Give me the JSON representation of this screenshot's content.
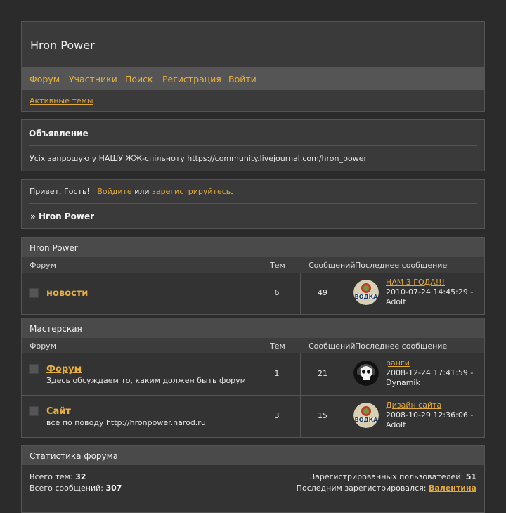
{
  "site": {
    "title": "Hron Power",
    "nav": [
      "Форум",
      "Участники",
      "Поиск",
      "Регистрация",
      "Войти"
    ],
    "active_topics": "Активные темы"
  },
  "announcement": {
    "heading": "Объявление",
    "text": "Усіх запрошую у НАШУ ЖЖ-спільноту https://community.livejournal.com/hron_power"
  },
  "welcome": {
    "greeting": "Привет, Гость!",
    "login": "Войдите",
    "or": "или",
    "register": "зарегистрируйтесь",
    "dot": ".",
    "crumb_sep": "»",
    "crumb": "Hron Power"
  },
  "columns": {
    "forum": "Форум",
    "topics": "Тем",
    "posts": "Сообщений",
    "last": "Последнее сообщение"
  },
  "categories": [
    {
      "name": "Hron Power",
      "forums": [
        {
          "name": "новости",
          "desc": "",
          "topics": "6",
          "posts": "49",
          "last_title": "НАМ 3 ГОДА!!!",
          "last_date": "2010-07-24 14:45:29 -",
          "last_author": "Adolf",
          "avatar": "vodka-icon"
        }
      ]
    },
    {
      "name": "Мастерская",
      "forums": [
        {
          "name": "Форум",
          "desc": "Здесь обсуждаем то, каким должен быть форум",
          "topics": "1",
          "posts": "21",
          "last_title": "ранги",
          "last_date": "2008-12-24 17:41:59 -",
          "last_author": "Dynamik",
          "avatar": "skull-icon"
        },
        {
          "name": "Сайт",
          "desc": "всё по поводу http://hronpower.narod.ru",
          "topics": "3",
          "posts": "15",
          "last_title": "Дизайн сайта",
          "last_date": "2008-10-29 12:36:06 -",
          "last_author": "Adolf",
          "avatar": "vodka-icon"
        }
      ]
    }
  ],
  "stats": {
    "heading": "Статистика форума",
    "topics_label": "Всего тем:",
    "topics_value": "32",
    "posts_label": "Всего сообщений:",
    "posts_value": "307",
    "users_label": "Зарегистрированных пользователей:",
    "users_value": "51",
    "newest_label": "Последним зарегистрировался:",
    "newest_value": "Валентина"
  },
  "colors": {
    "background": "#2b2b2b",
    "panel": "#3a3a3a",
    "nav_bar": "#555555",
    "link": "#e8b040"
  }
}
